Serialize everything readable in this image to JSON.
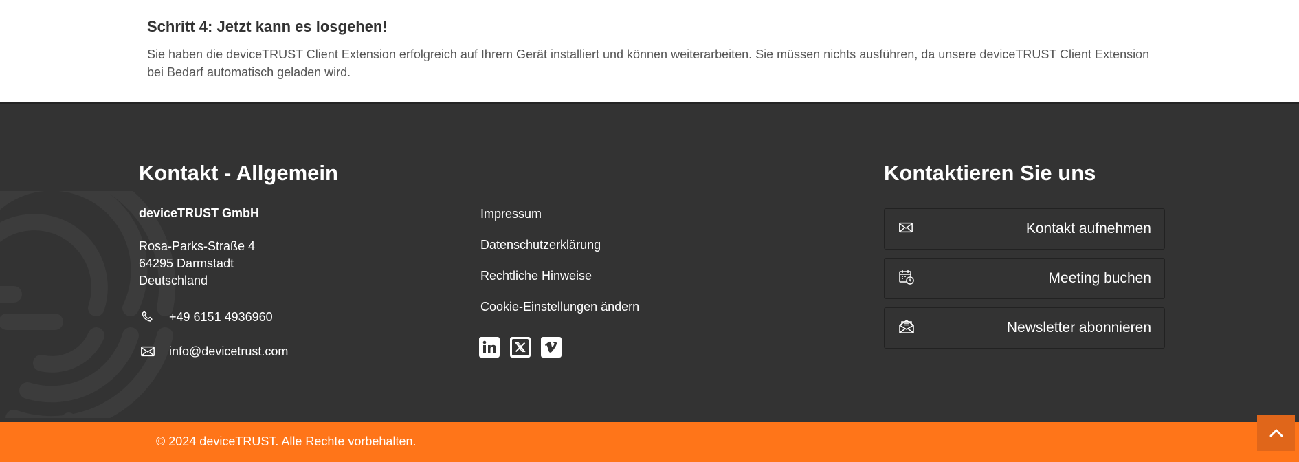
{
  "step": {
    "title": "Schritt 4: Jetzt kann es losgehen!",
    "text": "Sie haben die deviceTRUST Client Extension erfolgreich auf Ihrem Gerät installiert und können weiterarbeiten. Sie müssen nichts ausführen, da unsere deviceTRUST Client Extension bei Bedarf automatisch geladen wird."
  },
  "footer": {
    "contact": {
      "heading_bold": "Kontakt",
      "heading_rest": " - Allgemein",
      "company": "deviceTRUST GmbH",
      "address_line1": "Rosa-Parks-Straße 4",
      "address_line2": "64295 Darmstadt",
      "address_line3": "Deutschland",
      "phone": "+49 6151 4936960",
      "email": "info@devicetrust.com"
    },
    "links": [
      {
        "label": "Impressum"
      },
      {
        "label": "Datenschutzerklärung"
      },
      {
        "label": "Rechtliche Hinweise"
      },
      {
        "label": "Cookie-Einstellungen ändern"
      }
    ],
    "social": [
      "linkedin-icon",
      "x-twitter-icon",
      "vimeo-icon"
    ],
    "cta": {
      "heading": "Kontaktieren Sie uns",
      "buttons": [
        {
          "label": "Kontakt aufnehmen",
          "icon": "envelope-icon"
        },
        {
          "label": "Meeting buchen",
          "icon": "calendar-clock-icon"
        },
        {
          "label": "Newsletter abonnieren",
          "icon": "newsletter-icon"
        }
      ]
    }
  },
  "copyright": "© 2024 deviceTRUST. Alle Rechte vorbehalten.",
  "colors": {
    "footer_bg": "#333333",
    "accent_orange": "#ff7519",
    "scroll_button": "#e0661a"
  }
}
